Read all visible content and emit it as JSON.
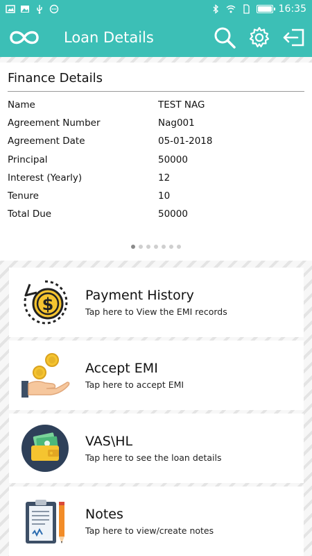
{
  "status_bar": {
    "time": "16:35",
    "left_icons": [
      "image-icon",
      "gallery-icon",
      "usb-icon",
      "message-icon"
    ],
    "right_icons": [
      "bluetooth-icon",
      "wifi-icon",
      "sim-icon",
      "battery-icon"
    ],
    "battery_level": 1.0
  },
  "appbar": {
    "title": "Loan Details",
    "logo_icon": "infinity-logo-icon",
    "actions": [
      "search-icon",
      "settings-icon",
      "logout-icon"
    ],
    "color": "#3cbfb6"
  },
  "finance": {
    "title": "Finance Details",
    "rows": [
      {
        "label": "Name",
        "value": "TEST NAG"
      },
      {
        "label": "Agreement Number",
        "value": "Nag001"
      },
      {
        "label": "Agreement Date",
        "value": "05-01-2018"
      },
      {
        "label": "Principal",
        "value": "50000"
      },
      {
        "label": "Interest (Yearly)",
        "value": "12"
      },
      {
        "label": "Tenure",
        "value": "10"
      },
      {
        "label": "Total Due",
        "value": "50000"
      }
    ],
    "page_count": 7,
    "active_page": 1
  },
  "menu": [
    {
      "title": "Payment History",
      "subtitle": "Tap here to View the EMI records",
      "icon": "dollar-coin-history-icon"
    },
    {
      "title": "Accept EMI",
      "subtitle": "Tap here to accept EMI",
      "icon": "hand-coins-icon"
    },
    {
      "title": "VAS\\HL",
      "subtitle": "Tap here to see the loan details",
      "icon": "wallet-cash-icon"
    },
    {
      "title": "Notes",
      "subtitle": "Tap here to view/create notes",
      "icon": "notes-clipboard-icon"
    }
  ]
}
